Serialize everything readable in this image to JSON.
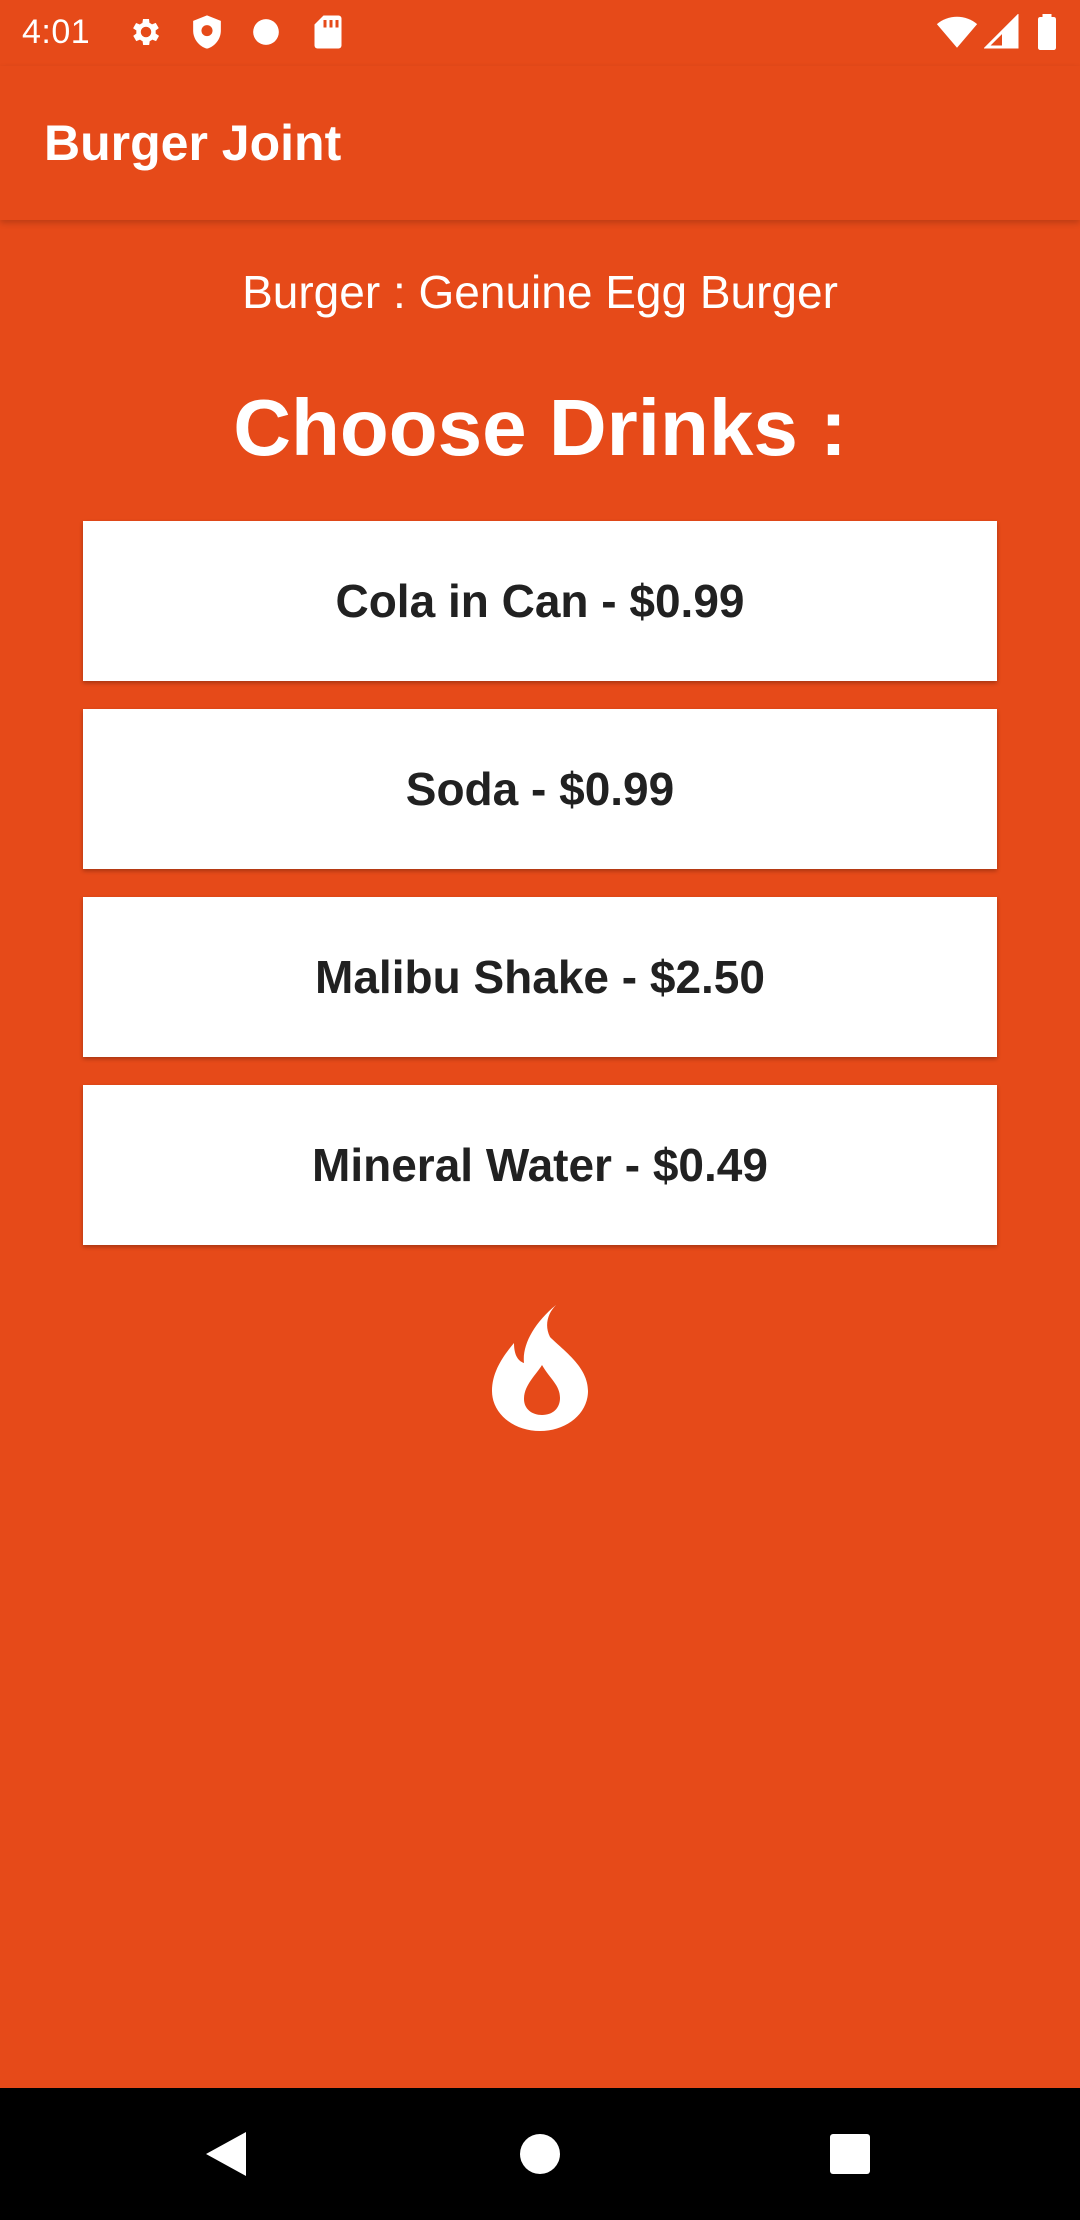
{
  "status_bar": {
    "time": "4:01",
    "left_icons": [
      "gear-icon",
      "shield-icon",
      "dot-icon",
      "sd-card-icon"
    ],
    "right_icons": [
      "wifi-icon",
      "signal-icon",
      "battery-icon"
    ]
  },
  "app_bar": {
    "title": "Burger Joint"
  },
  "main": {
    "burger_line": "Burger : Genuine Egg Burger",
    "section_title": "Choose Drinks :",
    "drinks": [
      {
        "label": "Cola in Can - $0.99"
      },
      {
        "label": "Soda - $0.99"
      },
      {
        "label": "Malibu Shake - $2.50"
      },
      {
        "label": "Mineral Water - $0.49"
      }
    ],
    "logo_icon": "fire-icon"
  },
  "nav_bar": {
    "buttons": [
      "back-icon",
      "home-icon",
      "recents-icon"
    ]
  },
  "colors": {
    "primary": "#E64A19",
    "button_bg": "#FFFFFF",
    "button_text": "#212121",
    "nav_bg": "#000000"
  }
}
